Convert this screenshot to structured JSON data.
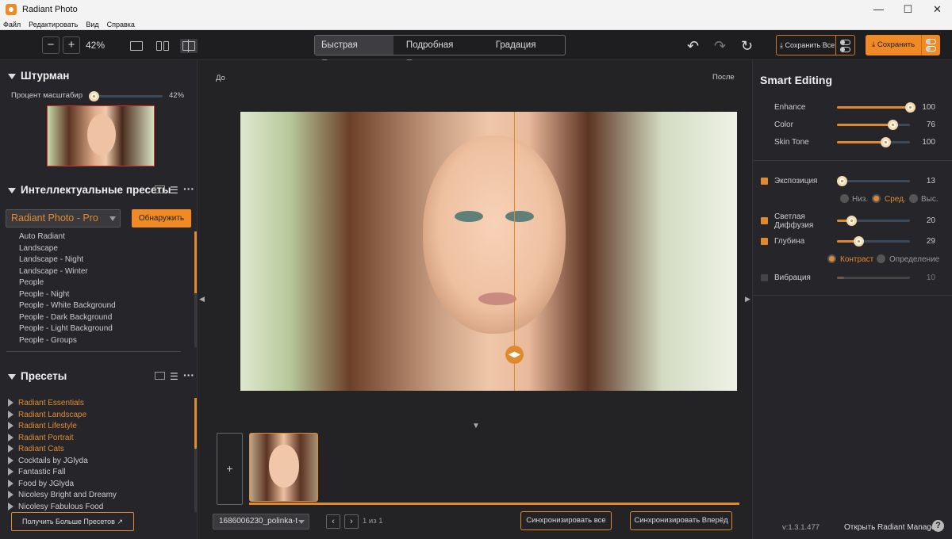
{
  "app": {
    "title": "Radiant Photo"
  },
  "menu": [
    "Файл",
    "Редактировать",
    "Вид",
    "Справка"
  ],
  "window_controls": [
    "—",
    "☐",
    "✕"
  ],
  "toolbar": {
    "zoom_value": "42%",
    "zoom_out": "−",
    "zoom_in": "+",
    "undo_glyph": "↶",
    "redo_glyph": "↷",
    "reset_glyph": "↻",
    "tabs": [
      {
        "label": "Быстрая Правка",
        "active": true
      },
      {
        "label": "Подробная Правка",
        "active": false
      },
      {
        "label": "Градация цвета",
        "active": false
      }
    ],
    "save_all_label": "Сохранить Все",
    "save_label": "Сохранить"
  },
  "navigator": {
    "title": "Штурман",
    "zoom_label": "Процент масштабир",
    "zoom_value": "42%",
    "zoom_fraction": 0.07
  },
  "smart_presets": {
    "title": "Интеллектуальные пресеты",
    "selected": "Radiant Photo - Pro",
    "detect_label": "Обнаружить",
    "items": [
      "Auto Radiant",
      "Landscape",
      "Landscape - Night",
      "Landscape - Winter",
      "People",
      "People - Night",
      "People - White Background",
      "People - Dark Background",
      "People - Light Background",
      "People - Groups"
    ]
  },
  "presets": {
    "title": "Пресеты",
    "items": [
      {
        "label": "Radiant Essentials",
        "accent": true
      },
      {
        "label": "Radiant Landscape",
        "accent": true
      },
      {
        "label": "Radiant Lifestyle",
        "accent": true
      },
      {
        "label": "Radiant Portrait",
        "accent": true
      },
      {
        "label": "Radiant Cats",
        "accent": true
      },
      {
        "label": "Cocktails by JGlyda",
        "accent": false
      },
      {
        "label": "Fantastic Fall",
        "accent": false
      },
      {
        "label": "Food by JGlyda",
        "accent": false
      },
      {
        "label": "Nicolesy Bright and Dreamy",
        "accent": false
      },
      {
        "label": "Nicolesy Fabulous Food",
        "accent": false
      }
    ],
    "more_label": "Получить Больше Пресетов"
  },
  "viewer": {
    "before_label": "До",
    "after_label": "После",
    "add_glyph": "+",
    "filename": "1686006230_polinka-t",
    "counter": "1 из 1",
    "sync_all_label": "Синхронизировать все",
    "sync_forward_label": "Синхронизировать Вперёд"
  },
  "smart_editing": {
    "title": "Smart Editing",
    "sliders": [
      {
        "label": "Enhance",
        "value": "100",
        "fraction": 1.0
      },
      {
        "label": "Color",
        "value": "76",
        "fraction": 0.76
      },
      {
        "label": "Skin Tone",
        "value": "100",
        "fraction": 0.66
      }
    ]
  },
  "adjustments": {
    "exposure": {
      "label": "Экспозиция",
      "value": "13",
      "fraction": 0.07,
      "checked": true
    },
    "exposure_levels": [
      "Низ.",
      "Сред.",
      "Выс."
    ],
    "exposure_level_selected": "Сред.",
    "diffusion": {
      "label1": "Светлая",
      "label2": "Диффузия",
      "value": "20",
      "fraction": 0.2,
      "checked": true
    },
    "depth": {
      "label": "Глубина",
      "value": "29",
      "fraction": 0.29,
      "checked": true
    },
    "depth_modes": [
      "Контраст",
      "Определение"
    ],
    "depth_mode_selected": "Контраст",
    "vibrance": {
      "label": "Вибрация",
      "value": "10",
      "fraction": 0.1,
      "checked": false
    }
  },
  "footer": {
    "version": "v:1.3.1.477",
    "manager_label": "Открыть Radiant Manager",
    "help_glyph": "?"
  },
  "colors": {
    "accent": "#e08a30",
    "panel": "#26262a",
    "bg": "#232326"
  }
}
